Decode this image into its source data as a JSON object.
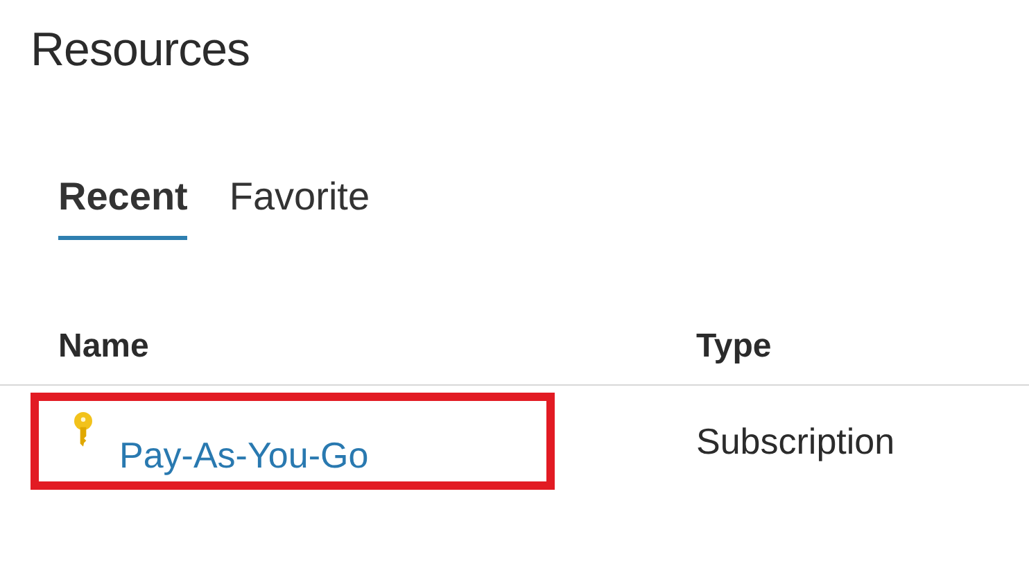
{
  "title": "Resources",
  "tabs": [
    {
      "label": "Recent",
      "selected": true
    },
    {
      "label": "Favorite",
      "selected": false
    }
  ],
  "table": {
    "columns": [
      "Name",
      "Type"
    ],
    "rows": [
      {
        "name": "Pay-As-You-Go",
        "type": "Subscription",
        "highlighted": true
      }
    ]
  }
}
